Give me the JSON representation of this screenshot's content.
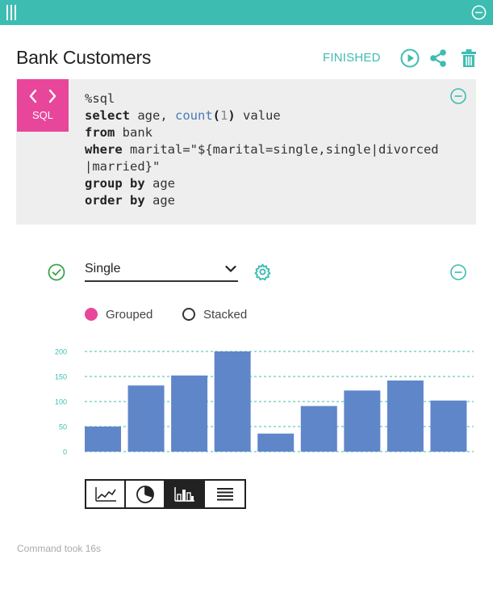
{
  "paragraph": {
    "title": "Bank Customers",
    "status": "FINISHED",
    "editor_label": "SQL",
    "code_lines": [
      [
        {
          "t": "%sql",
          "c": ""
        }
      ],
      [
        {
          "t": "select",
          "c": "kw"
        },
        {
          "t": " age, ",
          "c": ""
        },
        {
          "t": "count",
          "c": "fn"
        },
        {
          "t": "(",
          "c": "pn"
        },
        {
          "t": "1",
          "c": "nm"
        },
        {
          "t": ")",
          "c": "pn"
        },
        {
          "t": " value",
          "c": ""
        }
      ],
      [
        {
          "t": "from",
          "c": "kw"
        },
        {
          "t": " bank",
          "c": ""
        }
      ],
      [
        {
          "t": "where",
          "c": "kw"
        },
        {
          "t": " marital=\"${marital=single,single|divorced",
          "c": ""
        }
      ],
      [
        {
          "t": "|married}\"",
          "c": ""
        }
      ],
      [
        {
          "t": "group by",
          "c": "kw"
        },
        {
          "t": " age",
          "c": ""
        }
      ],
      [
        {
          "t": "order by",
          "c": "kw"
        },
        {
          "t": " age",
          "c": ""
        }
      ]
    ]
  },
  "form": {
    "select_value": "Single"
  },
  "options": {
    "grouped_label": "Grouped",
    "stacked_label": "Stacked",
    "selected": "Grouped"
  },
  "footer": {
    "text": "Command took 16s"
  },
  "colors": {
    "accent": "#3dbdb1",
    "pink": "#e8469b",
    "bar": "#5f86c9"
  },
  "chart_data": {
    "type": "bar",
    "y_ticks": [
      "0",
      "50",
      "100",
      "150",
      "200"
    ],
    "ylim": [
      0,
      200
    ],
    "values": [
      50,
      132,
      152,
      200,
      36,
      91,
      122,
      142,
      102
    ],
    "grid": "dashed horizontal"
  }
}
